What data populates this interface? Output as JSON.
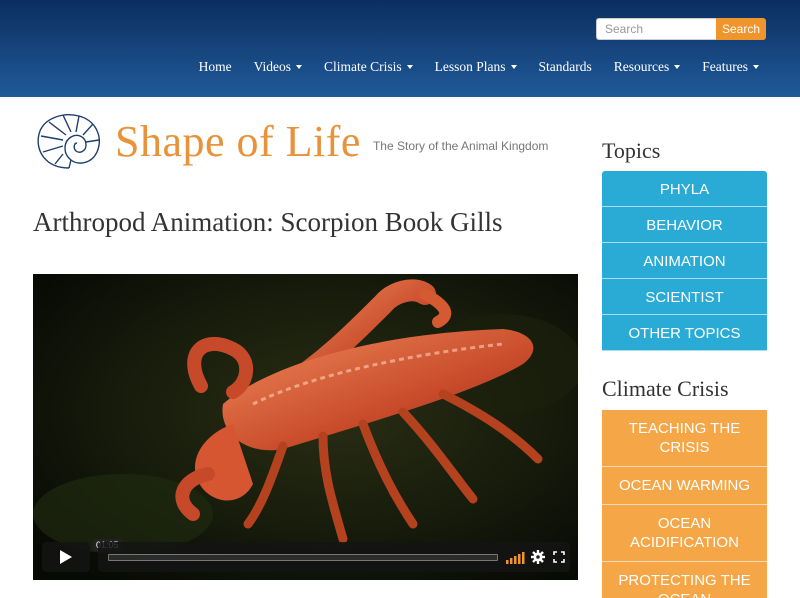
{
  "search": {
    "placeholder": "Search",
    "button_label": "Search"
  },
  "nav": {
    "items": [
      {
        "label": "Home",
        "has_dropdown": false
      },
      {
        "label": "Videos",
        "has_dropdown": true
      },
      {
        "label": "Climate Crisis",
        "has_dropdown": true
      },
      {
        "label": "Lesson Plans",
        "has_dropdown": true
      },
      {
        "label": "Standards",
        "has_dropdown": false
      },
      {
        "label": "Resources",
        "has_dropdown": true
      },
      {
        "label": "Features",
        "has_dropdown": true
      }
    ]
  },
  "logo": {
    "name": "Shape of Life",
    "tagline": "The Story of the Animal Kingdom",
    "icon": "nautilus-shell-icon"
  },
  "page": {
    "title": "Arthropod Animation: Scorpion Book Gills"
  },
  "video": {
    "time_tooltip": "01:05",
    "icons": [
      "play-icon",
      "volume-icon",
      "settings-icon",
      "fullscreen-icon"
    ]
  },
  "sidebar": {
    "topics_heading": "Topics",
    "topics": [
      "PHYLA",
      "BEHAVIOR",
      "ANIMATION",
      "SCIENTIST",
      "OTHER TOPICS"
    ],
    "climate_heading": "Climate Crisis",
    "climate": [
      "TEACHING THE CRISIS",
      "OCEAN WARMING",
      "OCEAN ACIDIFICATION",
      "PROTECTING THE OCEAN"
    ]
  },
  "colors": {
    "header_top": "#0b2e5f",
    "header_bottom": "#1f5a9a",
    "accent_orange": "#f0942c",
    "topic_blue": "#29abd6",
    "climate_orange": "#f5a646"
  }
}
